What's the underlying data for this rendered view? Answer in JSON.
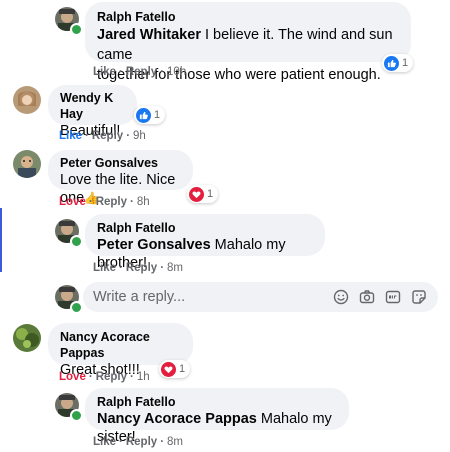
{
  "comments": [
    {
      "author": "Ralph Fatello",
      "mention": "Jared Whitaker",
      "text_line1": " I believe it. The wind and sun came",
      "text_line2": "together for those who were patient enough.",
      "like": "Like",
      "reply": "Reply",
      "time": "10h",
      "reaction_count": "1"
    },
    {
      "author": "Wendy K Hay",
      "text": "Beautiful!",
      "like": "Like",
      "reply": "Reply",
      "time": "9h",
      "reaction_count": "1"
    },
    {
      "author": "Peter Gonsalves",
      "text": "Love the lite. Nice one",
      "emoji": "👍",
      "love": "Love",
      "reply": "Reply",
      "time": "8h",
      "reaction_count": "1"
    },
    {
      "author": "Ralph Fatello",
      "mention": "Peter Gonsalves",
      "text": " Mahalo my brother!",
      "like": "Like",
      "reply": "Reply",
      "time": "8m"
    },
    {
      "author": "Nancy Acorace Pappas",
      "text": "Great shot!!!",
      "love": "Love",
      "reply": "Reply",
      "time": "1h",
      "reaction_count": "1"
    },
    {
      "author": "Ralph Fatello",
      "mention": "Nancy Acorace Pappas",
      "text": " Mahalo my sister!",
      "like": "Like",
      "reply": "Reply",
      "time": "8m"
    }
  ],
  "reply_box": {
    "placeholder": "Write a reply...",
    "icons": [
      "emoji-icon",
      "camera-icon",
      "gif-icon",
      "sticker-icon"
    ]
  },
  "separator": "·",
  "colors": {
    "like_blue": "#1877f2",
    "love_red": "#e41e3f",
    "bubble_bg": "#f0f2f5",
    "meta_gray": "#65676b",
    "thread_line": "#3b5bd9"
  }
}
